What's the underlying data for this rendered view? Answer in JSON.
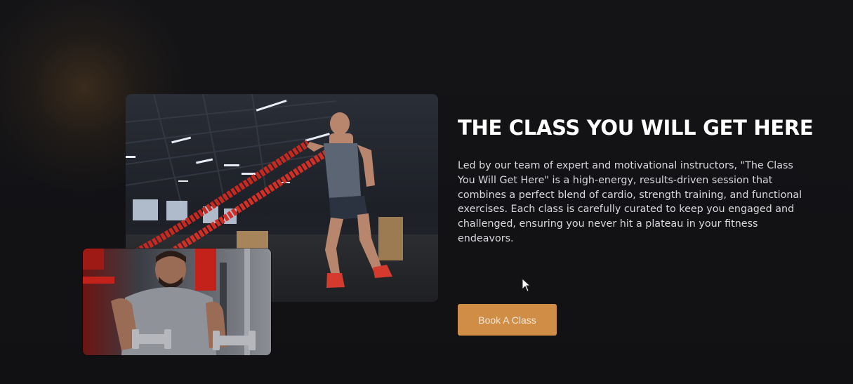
{
  "section": {
    "heading": "THE CLASS YOU WILL GET HERE",
    "description": "Led by our team of expert and motivational instructors, \"The Class You Will Get Here\" is a high-energy, results-driven session that combines a perfect blend of cardio, strength training, and functional exercises. Each class is carefully curated to keep you engaged and challenged, ensuring you never hit a plateau in your fitness endeavors.",
    "cta_label": "Book A Class"
  },
  "images": {
    "main_alt": "battle-ropes-workout-photo",
    "secondary_alt": "dumbbell-curl-photo"
  },
  "colors": {
    "background": "#121215",
    "accent": "#cf8d45",
    "heading": "#ffffff",
    "body_text": "#d9d9de"
  },
  "icons": [
    "cursor-icon"
  ]
}
